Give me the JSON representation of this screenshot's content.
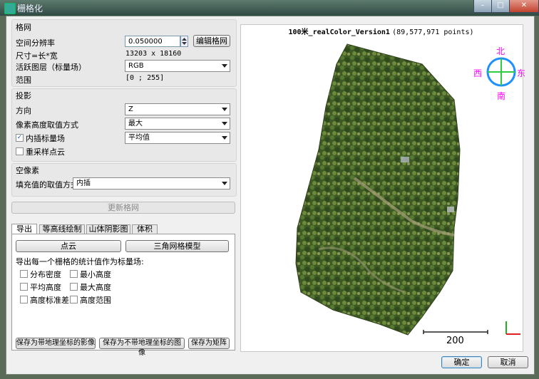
{
  "window": {
    "title": "栅格化",
    "close_glyph": "✕",
    "minimize_glyph": "–",
    "maximize_glyph": "□"
  },
  "grid": {
    "title": "格网",
    "step_label": "空间分辨率",
    "step_value": "0.050000",
    "edit_grid_label": "编辑格网",
    "size_label": "尺寸=长*宽",
    "size_value": "13203 x 18160",
    "active_layer_label": "活跃图层（标量场）",
    "active_layer_value": "RGB",
    "range_label": "范围",
    "range_value": "[0 ; 255]"
  },
  "projection": {
    "title": "投影",
    "direction_label": "方向",
    "direction_value": "Z",
    "cell_height_label": "像素高度取值方式",
    "cell_height_value": "最大",
    "interpolate_sf_label": "内插标量场",
    "interpolate_sf_checked": true,
    "interpolate_sf_value": "平均值",
    "resample_label": "重采样点云",
    "resample_checked": false
  },
  "empty_cells": {
    "title": "空像素",
    "fill_label": "填充值的取值方式",
    "fill_value": "内插"
  },
  "update_grid_label": "更新格网",
  "tabs": [
    {
      "label": "导出",
      "active": true
    },
    {
      "label": "等高线绘制",
      "active": false
    },
    {
      "label": "山体阴影图",
      "active": false
    },
    {
      "label": "体积",
      "active": false
    }
  ],
  "export": {
    "cloud_button": "点云",
    "mesh_button": "三角网格模型",
    "stats_label": "导出每一个栅格的统计值作为标量场:",
    "stats": [
      {
        "label": "分布密度",
        "checked": false
      },
      {
        "label": "最小高度",
        "checked": false
      },
      {
        "label": "平均高度",
        "checked": false
      },
      {
        "label": "最大高度",
        "checked": false
      },
      {
        "label": "高度标准差",
        "checked": false
      },
      {
        "label": "高度范围",
        "checked": false
      }
    ],
    "save_geo_button": "保存为带地理坐标的影像",
    "save_nogeo_button": "保存为不带地理坐标的图像",
    "save_matrix_button": "保存为矩阵"
  },
  "viewer": {
    "cloud_name": "100米_realColor_Version1",
    "point_count": "(89,577,971 points)",
    "compass": {
      "north": "北",
      "south": "南",
      "east": "东",
      "west": "西"
    },
    "scale_value": "200"
  },
  "dialog": {
    "ok_label": "确定",
    "cancel_label": "取消"
  },
  "colors": {
    "compass_labels": "#ff00ff",
    "compass_circle": "#1e90ff",
    "compass_cross": "#2ecc40",
    "axis_x": "#e02020",
    "axis_y": "#20b020"
  }
}
